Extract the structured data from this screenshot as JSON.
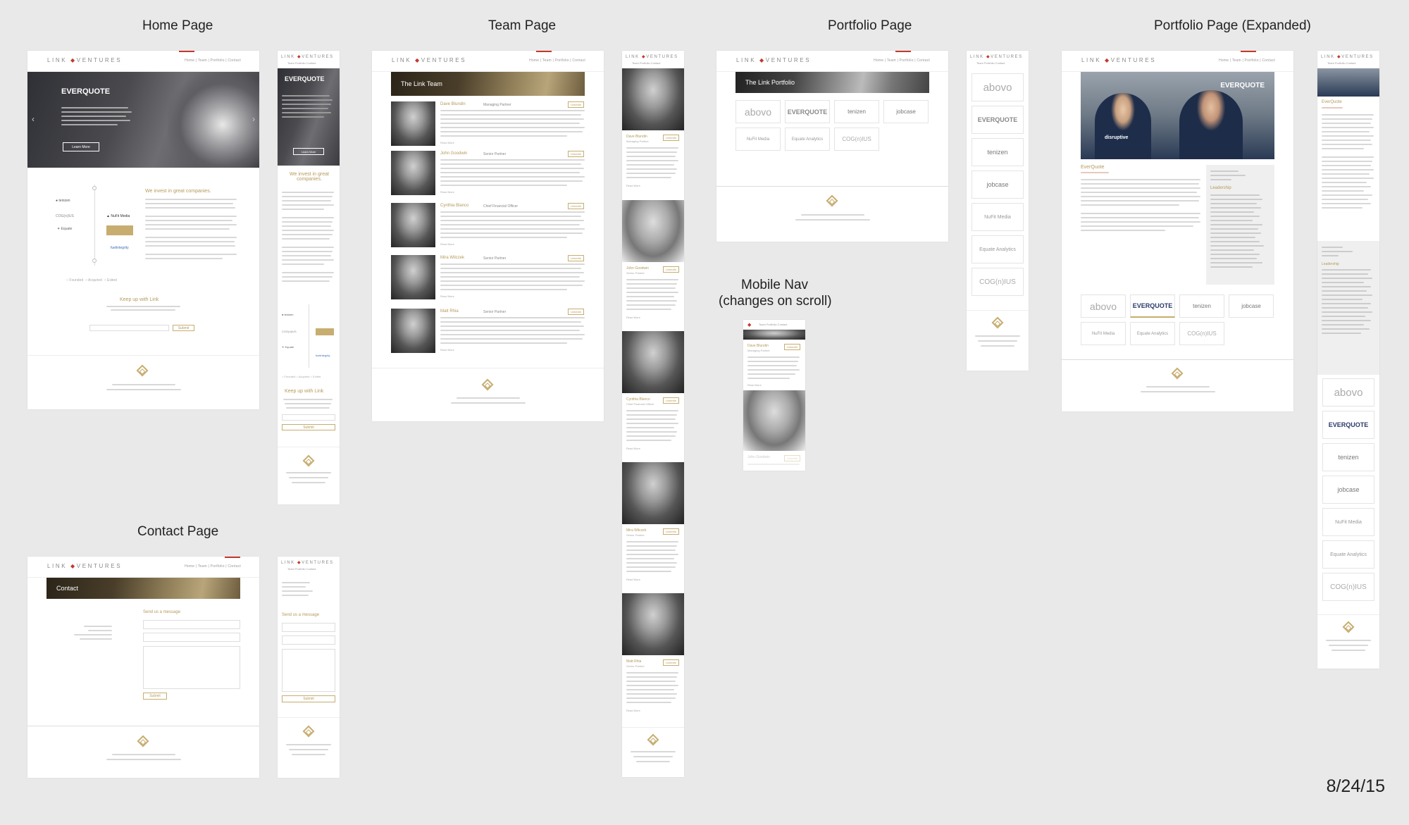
{
  "labels": {
    "home": "Home Page",
    "team": "Team Page",
    "portfolio": "Portfolio Page",
    "portfolio_expanded": "Portfolio Page (Expanded)",
    "contact": "Contact Page",
    "mobile_nav_1": "Mobile Nav",
    "mobile_nav_2": "(changes on scroll)",
    "date": "8/24/15"
  },
  "brand": {
    "logo_left": "LINK",
    "logo_right": "VENTURES",
    "nav": "Home  |  Team  |  Portfolio  |  Contact",
    "mobile_nav": "Team   Portfolio   Contact",
    "accent": "#c23a2e",
    "gold": "#c7ad70"
  },
  "home": {
    "hero_logo": "EVERQUOTE",
    "hero_btn": "Learn More",
    "heading": "We invest in great companies.",
    "keep_up": "Keep up with Link",
    "subscribe": "Submit",
    "mobile_heading": "We invest in great companies.",
    "mobile_keep_up": "Keep up with Link"
  },
  "team": {
    "banner": "The Link Team",
    "members": [
      {
        "name": "Dave Blundin",
        "role": "Managing Partner"
      },
      {
        "name": "John Goodwin",
        "role": "Senior Partner"
      },
      {
        "name": "Cynthia Blanco",
        "role": "Chief Financial Officer"
      },
      {
        "name": "Mira Wilczek",
        "role": "Senior Partner"
      },
      {
        "name": "Matt Rhia",
        "role": "Senior Partner"
      }
    ],
    "read_more": "Read More",
    "linkedin": "LinkedIn"
  },
  "portfolio": {
    "banner": "The Link Portfolio",
    "companies": [
      "abovo",
      "EVERQUOTE",
      "tenizen",
      "jobcase",
      "NuFit Media",
      "Equate Analytics",
      "COG(n)IUS"
    ]
  },
  "portfolio_expanded": {
    "hero_logo": "EVERQUOTE",
    "shirt_text": "disruptive",
    "company": "EverQuote",
    "leadership": "Leadership"
  },
  "contact": {
    "banner": "Contact",
    "send": "Send us a message",
    "submit": "Submit"
  }
}
